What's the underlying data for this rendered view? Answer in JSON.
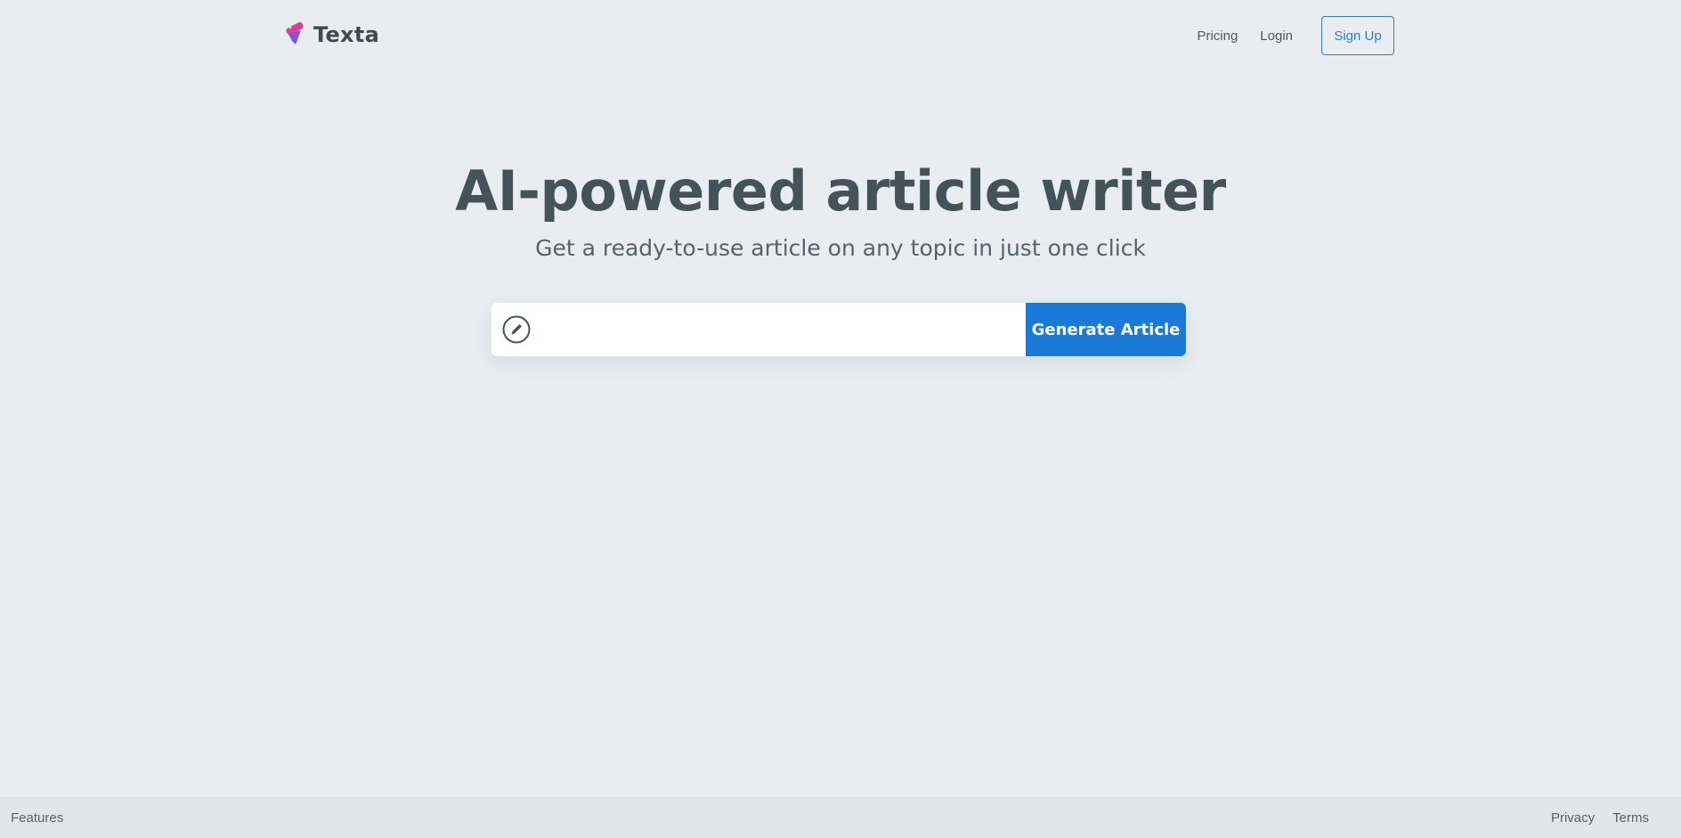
{
  "brand": {
    "name": "Texta",
    "logo_icon": "texta-logo-icon",
    "colors": {
      "pink": "#e23d8b",
      "purple": "#8c4bdb",
      "blue": "#4a6ee0"
    }
  },
  "nav": {
    "pricing": "Pricing",
    "login": "Login",
    "signup": "Sign Up"
  },
  "hero": {
    "title": "AI-powered article writer",
    "subtitle": "Get a ready-to-use article on any topic in just one click"
  },
  "generator": {
    "icon": "pencil-icon",
    "input_value": "",
    "input_placeholder": "",
    "button_label": "Generate Article",
    "button_color": "#1a7ad8"
  },
  "footer": {
    "features": "Features",
    "privacy": "Privacy",
    "terms": "Terms"
  }
}
